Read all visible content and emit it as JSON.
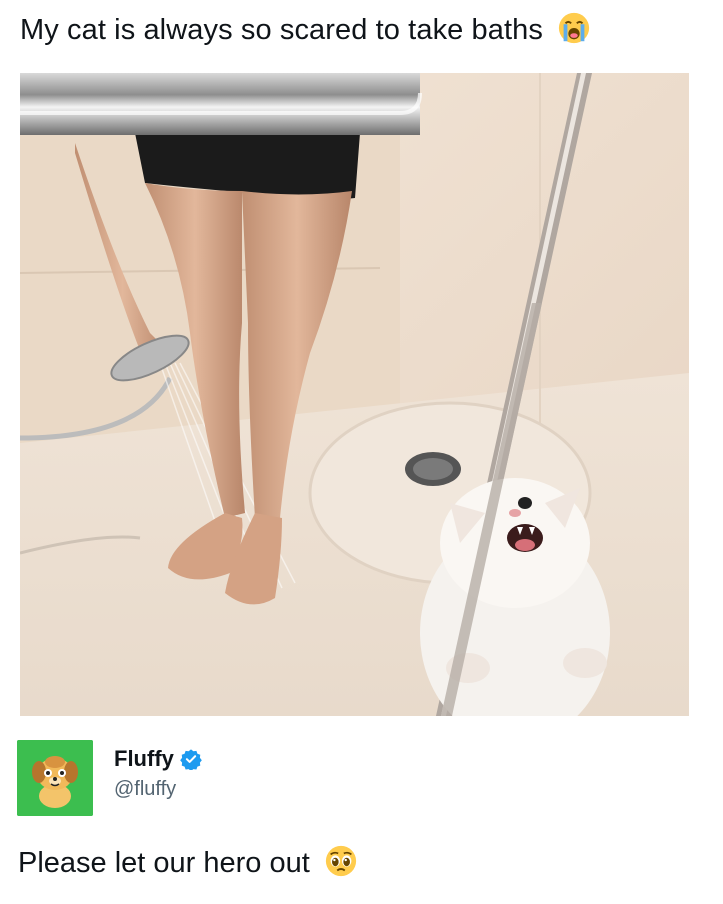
{
  "post_header": {
    "caption": "My cat is always so scared to take baths",
    "caption_emoji": "loudly-crying-face-emoji"
  },
  "photo": {
    "description_icon": "cat-in-shower-photo"
  },
  "account": {
    "display_name": "Fluffy",
    "handle": "@fluffy",
    "verified": true,
    "avatar_icon": "dog-cartoon-avatar",
    "verified_icon": "verified-badge-icon",
    "verified_color": "#1d9bf0",
    "avatar_bg": "#3cbe4f"
  },
  "reply": {
    "text": "Please let our hero out",
    "text_emoji": "pleading-face-emoji"
  }
}
